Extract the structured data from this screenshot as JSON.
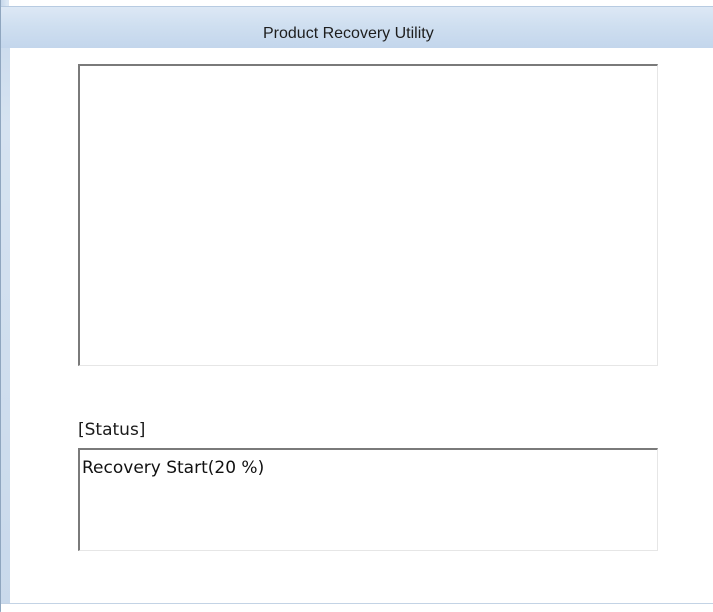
{
  "window": {
    "title": "Product Recovery Utility",
    "accent_color": "#c3d6ec"
  },
  "status": {
    "label": "[Status]",
    "message": "Recovery Start(20 %)",
    "progress_percent": 20
  }
}
